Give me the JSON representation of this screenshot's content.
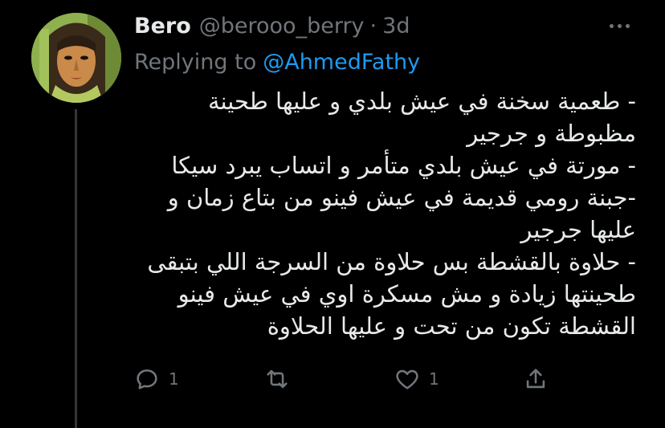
{
  "tweet": {
    "display_name": "Bero",
    "handle": "@berooo_berry",
    "separator": "·",
    "time": "3d",
    "replying_prefix": "Replying to",
    "replying_to": "@AhmedFathy",
    "text": "- طعمية سخنة في عيش بلدي و عليها طحينة\nمظبوطة و جرجير\n- مورتة في عيش بلدي متأمر و اتساب يبرد سيكا\n-جبنة رومي قديمة في عيش فينو من بتاع زمان و\nعليها جرجير\n- حلاوة بالقشطة بس حلاوة من السرجة اللي بتبقى\nطحينتها زيادة و مش مسكرة اوي في عيش فينو\nالقشطة تكون من تحت و عليها الحلاوة"
  },
  "actions": {
    "reply_count": "1",
    "retweet_count": "",
    "like_count": "1"
  },
  "icons": {
    "more": "more-horizontal-icon",
    "reply": "reply-icon",
    "retweet": "retweet-icon",
    "like": "heart-icon",
    "share": "share-icon"
  },
  "colors": {
    "background": "#000000",
    "text": "#e7e9ea",
    "muted": "#71767b",
    "link": "#1d9bf0"
  }
}
